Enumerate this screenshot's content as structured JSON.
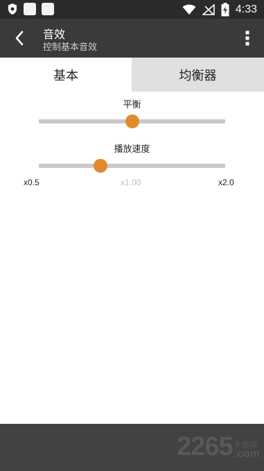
{
  "statusbar": {
    "time": "4:33"
  },
  "toolbar": {
    "title": "音效",
    "subtitle": "控制基本音效"
  },
  "tabs": [
    {
      "label": "基本",
      "active": true
    },
    {
      "label": "均衡器",
      "active": false
    }
  ],
  "balance": {
    "label": "平衡",
    "value": 0.5
  },
  "speed": {
    "label": "播放速度",
    "value": 0.33,
    "min_label": "x0.5",
    "mid_label": "x1.00",
    "max_label": "x2.0"
  },
  "watermark": {
    "main": "2265",
    "side_top": "手游网",
    "side_bottom": ".com"
  },
  "colors": {
    "accent": "#e08a2e",
    "toolbar": "#3a3a3a",
    "statusbar": "#2b2b2b"
  }
}
